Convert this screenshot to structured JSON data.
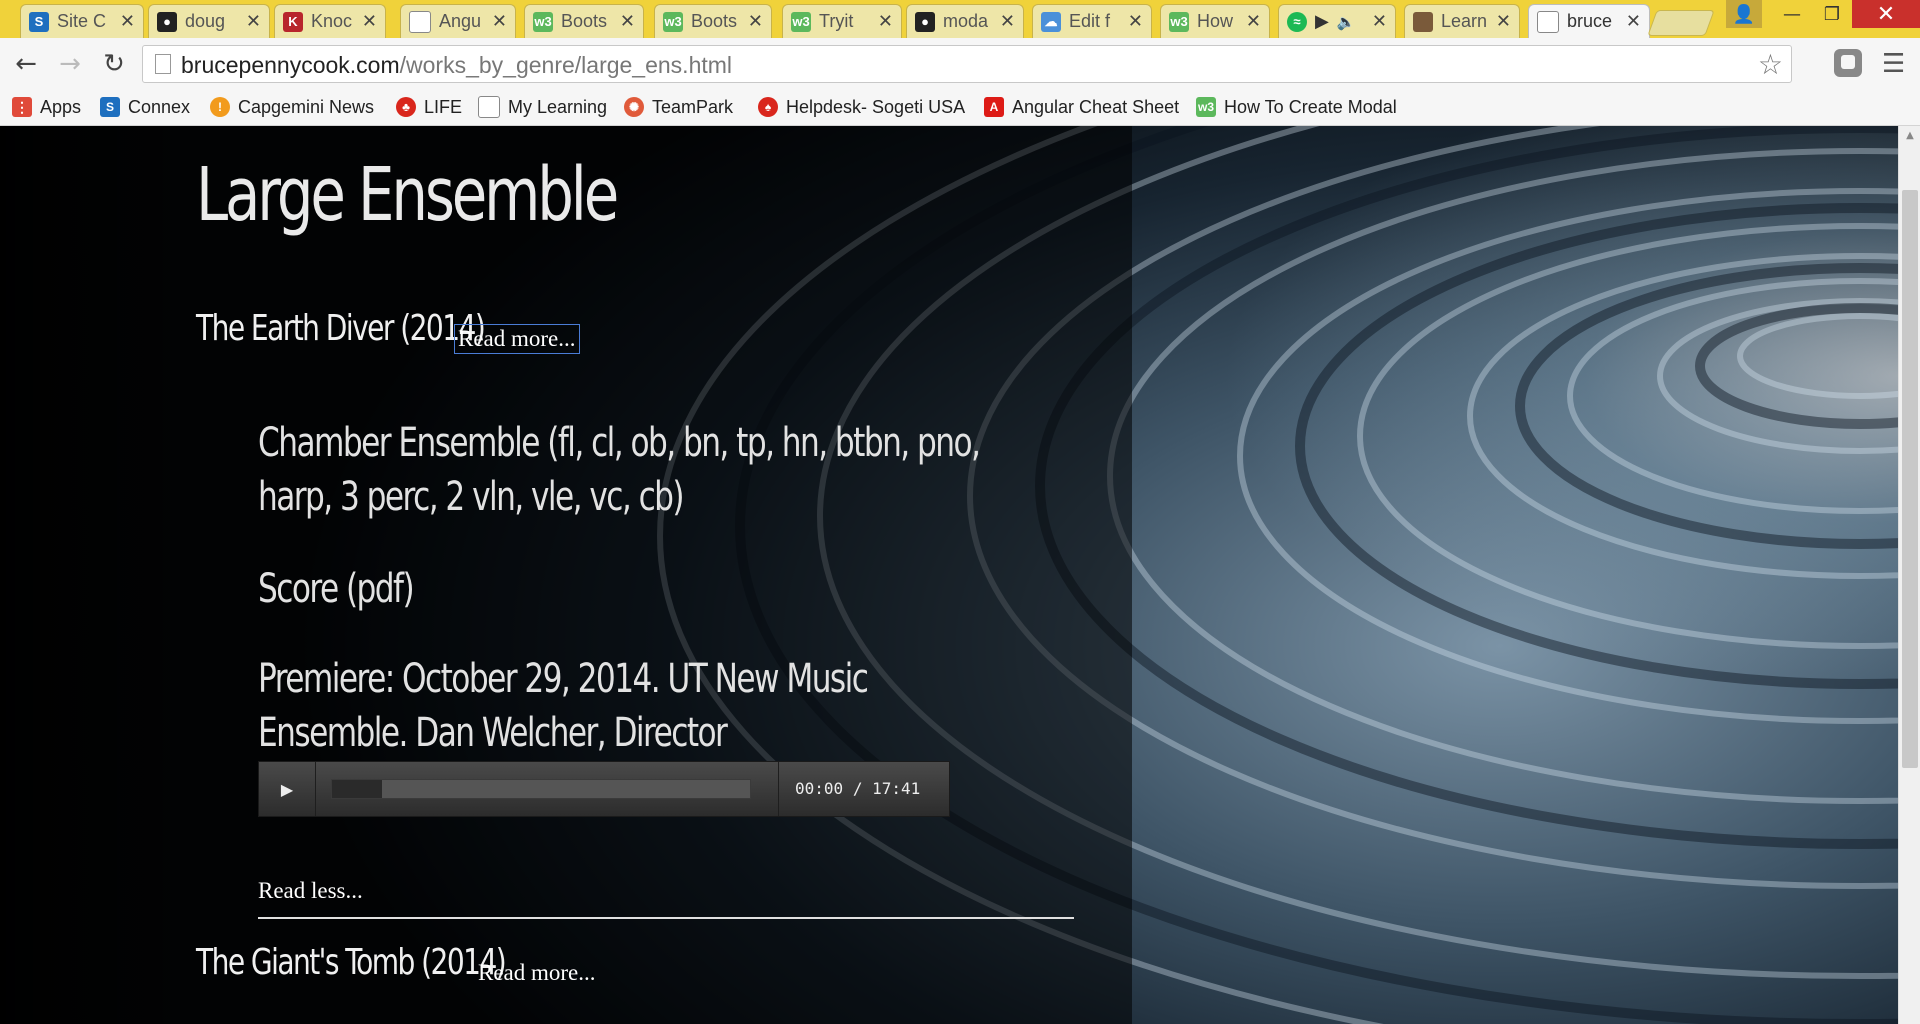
{
  "tabs": [
    {
      "title": "Site C",
      "icon": "sharepoint-icon",
      "color": "#1e6fbf"
    },
    {
      "title": "doug",
      "icon": "github-icon",
      "color": "#222222"
    },
    {
      "title": "Knoc",
      "icon": "knockout-icon",
      "color": "#b8262c"
    },
    {
      "title": "Angu",
      "icon": "page-icon",
      "color": "#ffffff"
    },
    {
      "title": "Boots",
      "icon": "w3-icon",
      "color": "#5cb85c"
    },
    {
      "title": "Boots",
      "icon": "w3-icon",
      "color": "#5cb85c"
    },
    {
      "title": "Tryit",
      "icon": "w3-icon",
      "color": "#5cb85c"
    },
    {
      "title": "moda",
      "icon": "github-icon",
      "color": "#222222"
    },
    {
      "title": "Edit f",
      "icon": "cloud-icon",
      "color": "#4a90d9"
    },
    {
      "title": "How",
      "icon": "w3-icon",
      "color": "#5cb85c"
    },
    {
      "title": "",
      "icon": "spotify-icon",
      "color": "#1db954"
    },
    {
      "title": "Learn",
      "icon": "photo-icon",
      "color": "#7a5a3a"
    },
    {
      "title": "bruce",
      "icon": "page-icon",
      "color": "#ffffff"
    }
  ],
  "addressbar": {
    "domain": "brucepennycook.com",
    "path": "/works_by_genre/large_ens.html"
  },
  "bookmarks": [
    {
      "label": "Apps",
      "icon": "apps-grid-icon",
      "color": "#e04a3a"
    },
    {
      "label": "Connex",
      "icon": "sharepoint-icon",
      "color": "#1e6fbf"
    },
    {
      "label": "Capgemini News",
      "icon": "capgemini-icon",
      "color": "#f29b1d"
    },
    {
      "label": "LIFE",
      "icon": "life-icon",
      "color": "#d9261c"
    },
    {
      "label": "My Learning",
      "icon": "page-icon",
      "color": "#ffffff"
    },
    {
      "label": "TeamPark",
      "icon": "teampark-icon",
      "color": "#e05a3a"
    },
    {
      "label": "Helpdesk- Sogeti USA",
      "icon": "helpdesk-icon",
      "color": "#d9261c"
    },
    {
      "label": "Angular Cheat Sheet",
      "icon": "angular-icon",
      "color": "#dd1b16"
    },
    {
      "label": "How To Create Modal",
      "icon": "w3-icon",
      "color": "#5cb85c"
    }
  ],
  "page": {
    "heading": "Large Ensemble",
    "works": [
      {
        "title": "The Earth Diver (2014)",
        "read_more": "Read more..."
      },
      {
        "title": "The Giant's Tomb (2014)",
        "read_more": "Read more..."
      }
    ],
    "details": {
      "instrumentation": "Chamber Ensemble (fl, cl, ob, bn, tp, hn, btbn, pno, harp, 3 perc, 2 vln, vle, vc, cb)",
      "score": "Score (pdf)",
      "premiere": "Premiere: October 29, 2014. UT New Music Ensemble. Dan Welcher, Director"
    },
    "player": {
      "current_time": "00:00",
      "separator": "/",
      "duration": "17:41",
      "buffered_fraction": 0.12
    },
    "read_less": "Read less..."
  }
}
